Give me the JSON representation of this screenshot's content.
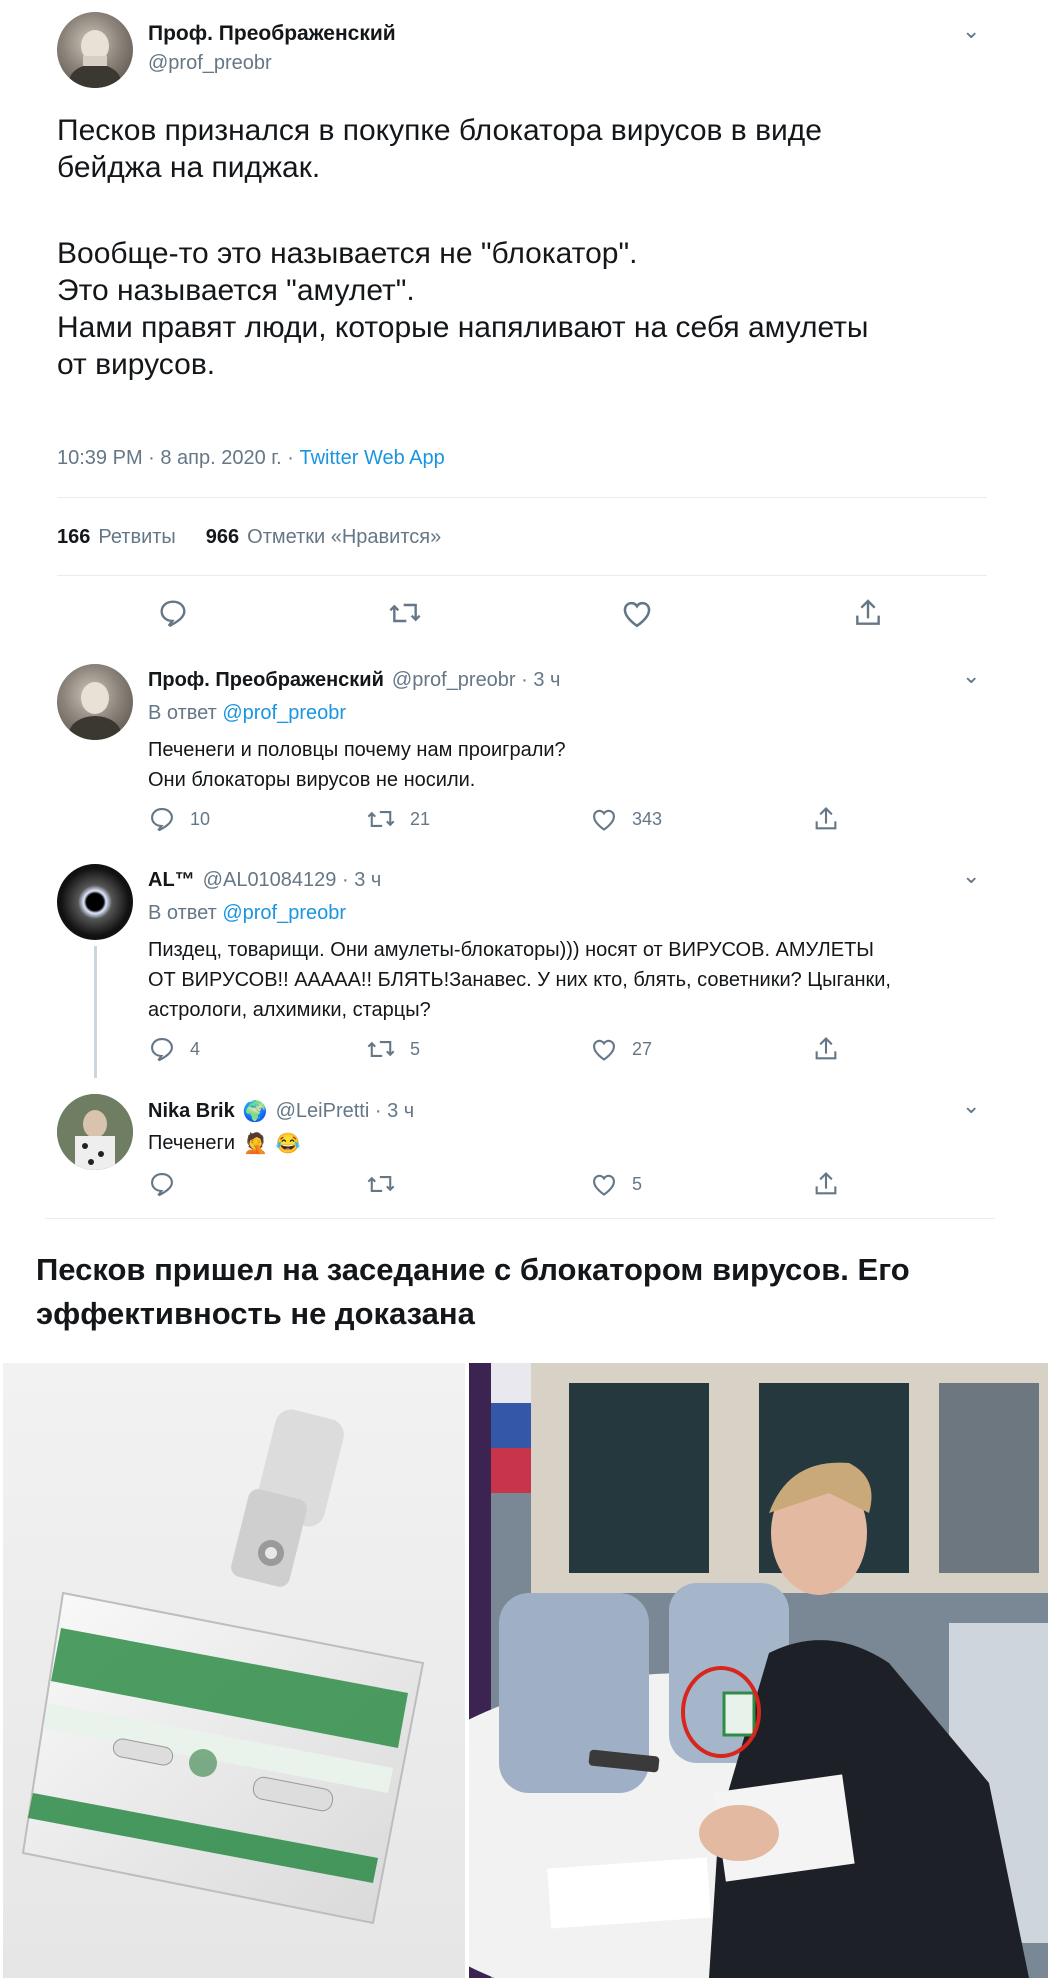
{
  "main_tweet": {
    "author_name": "Проф. Преображенский",
    "author_handle": "@prof_preobr",
    "text_lines": [
      "Песков признался в покупке блокатора вирусов в виде",
      "бейджа на пиджак.",
      "",
      "Вообще-то это называется не \"блокатор\".",
      "Это называется \"амулет\".",
      "Нами правят люди, которые напяливают на себя амулеты",
      "от вирусов."
    ],
    "time": "10:39 PM · 8 апр. 2020 г. · ",
    "source": "Twitter Web App",
    "retweets_count": "166",
    "retweets_label": "Ретвиты",
    "likes_count": "966",
    "likes_label": "Отметки «Нравится»"
  },
  "replies": [
    {
      "author_name": "Проф. Преображенский",
      "author_handle": "@prof_preobr · 3 ч",
      "reply_to_label": "В ответ ",
      "reply_to": "@prof_preobr",
      "text_lines": [
        "Печенеги и половцы почему нам проиграли?",
        "Они блокаторы вирусов не носили."
      ],
      "reply_count": "10",
      "retweet_count": "21",
      "like_count": "343"
    },
    {
      "author_name": "AL™",
      "author_handle": "@AL01084129 · 3 ч",
      "reply_to_label": "В ответ ",
      "reply_to": "@prof_preobr",
      "text_lines": [
        "Пиздец, товарищи. Они амулеты-блокаторы))) носят от ВИРУСОВ. АМУЛЕТЫ",
        "ОТ ВИРУСОВ!! ААААА!! БЛЯТЬ!Занавес. У них кто, блять, советники? Цыганки,",
        "астрологи, алхимики, старцы?"
      ],
      "reply_count": "4",
      "retweet_count": "5",
      "like_count": "27"
    },
    {
      "author_name": "Nika Brik",
      "author_handle": "@LeiPretti · 3 ч",
      "text": "Печенеги",
      "reply_count": "",
      "retweet_count": "",
      "like_count": "5"
    }
  ],
  "caption_lines": [
    "Песков пришел на заседание с блокатором вирусов. Его",
    "эффективность не доказана"
  ],
  "colors": {
    "link": "#1b95e0",
    "grey": "#657786",
    "divider": "#e6ecf0",
    "highlight_circle": "#d9261c"
  }
}
